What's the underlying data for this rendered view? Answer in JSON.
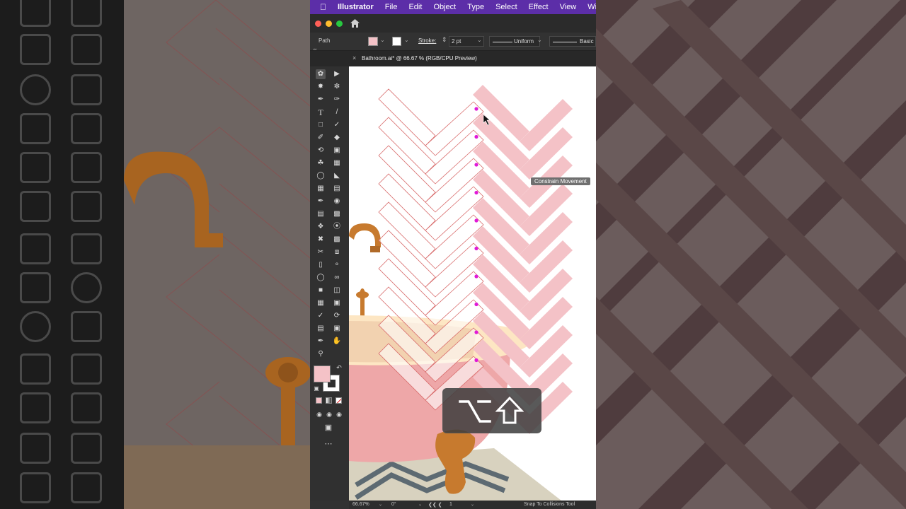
{
  "menubar": {
    "app": "Illustrator",
    "items": [
      "File",
      "Edit",
      "Object",
      "Type",
      "Select",
      "Effect",
      "View",
      "Windo"
    ]
  },
  "control": {
    "selection": "Path",
    "stroke_label": "Stroke:",
    "stroke_value": "2 pt",
    "profile": "Uniform",
    "brush": "Basic"
  },
  "document": {
    "tab_title": "Bathroom.ai* @ 66.67 % (RGB/CPU Preview)"
  },
  "tooltip": "Constrain Movement",
  "status": {
    "zoom": "66.67%",
    "rotation": "0°",
    "artboard": "1",
    "tool": "Snap To Collisions Tool"
  },
  "keys": [
    "option-key-icon",
    "shift-key-icon"
  ],
  "colors": {
    "menubar": "#5c2ea8",
    "tile_pink": "#f4c2c7",
    "tile_outline": "#d86a6a",
    "anchor": "#e01ad8",
    "tub": "#eea7a8",
    "faucet": "#c77a2e"
  }
}
